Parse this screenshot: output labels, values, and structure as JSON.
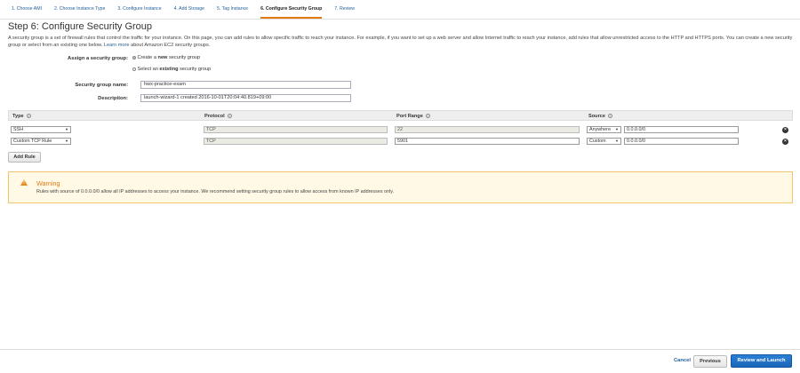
{
  "tabs": [
    {
      "label": "1. Choose AMI"
    },
    {
      "label": "2. Choose Instance Type"
    },
    {
      "label": "3. Configure Instance"
    },
    {
      "label": "4. Add Storage"
    },
    {
      "label": "5. Tag Instance"
    },
    {
      "label": "6. Configure Security Group",
      "active": true
    },
    {
      "label": "7. Review"
    }
  ],
  "page": {
    "title": "Step 6: Configure Security Group",
    "intro": "A security group is a set of firewall rules that control the traffic for your instance. On this page, you can add rules to allow specific traffic to reach your instance. For example, if you want to set up a web server and allow Internet traffic to reach your instance, add rules that allow unrestricted access to the HTTP and HTTPS ports. You can create a new security group or select from an existing one below.",
    "learn_more": "Learn more",
    "intro_tail": "about Amazon EC2 security groups."
  },
  "form": {
    "assign_label": "Assign a security group:",
    "option_create_pre": "Create a",
    "option_create_bold": "new",
    "option_create_post": "security group",
    "option_select_pre": "Select an",
    "option_select_bold": "existing",
    "option_select_post": "security group",
    "selected_option": "create",
    "name_label": "Security group name:",
    "name_value": "hwx-practice-exam",
    "desc_label": "Description:",
    "desc_value": "launch-wizard-1 created 2016-10-01T20:04:40.819+09:00"
  },
  "table": {
    "headers": {
      "type": "Type",
      "protocol": "Protocol",
      "port": "Port Range",
      "source": "Source"
    },
    "info_glyph": "i",
    "rows": [
      {
        "type": "SSH",
        "protocol": "TCP",
        "port": "22",
        "source_type": "Anywhere",
        "source_cidr": "0.0.0.0/0"
      },
      {
        "type": "Custom TCP Rule",
        "protocol": "TCP",
        "port": "5901",
        "source_type": "Custom",
        "source_cidr": "0.0.0.0/0"
      }
    ],
    "add_rule_label": "Add Rule",
    "remove_glyph": "×",
    "dropdown_glyph": "▼"
  },
  "warning": {
    "title": "Warning",
    "text": "Rules with source of 0.0.0.0/0 allow all IP addresses to access your instance. We recommend setting security group rules to allow access from known IP addresses only.",
    "icon": "warning-triangle-icon",
    "icon_glyph": "!"
  },
  "footer": {
    "cancel": "Cancel",
    "previous": "Previous",
    "review_launch": "Review and Launch"
  },
  "colors": {
    "accent": "#e47911",
    "link": "#1f5d98",
    "primary_button": "#1a66b8"
  }
}
